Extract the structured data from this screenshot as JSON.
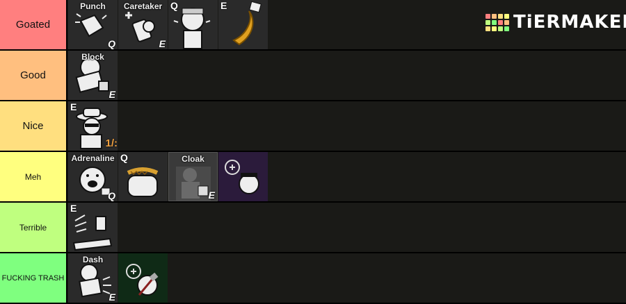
{
  "logo": {
    "text": "TiERMAKER",
    "grid_colors": [
      "#ff7f7f",
      "#ffbf7f",
      "#ffdf7f",
      "#ffff7f",
      "#bfff7f",
      "#7fff7f",
      "#ff7f7f",
      "#ffbf7f",
      "#ffdf7f",
      "#ffff7f",
      "#bfff7f",
      "#7fff7f"
    ]
  },
  "tiers": [
    {
      "label": "Goated",
      "color": "#ff7f7f",
      "font_size": 15,
      "items": [
        {
          "name": "Punch",
          "key_br": "Q",
          "icon": "fist-icon"
        },
        {
          "name": "Caretaker",
          "key_br": "E",
          "icon": "medkit-icon"
        },
        {
          "name": "",
          "key_tl": "Q",
          "icon": "crying-survivor-icon"
        },
        {
          "name": "",
          "key_tl": "E",
          "icon": "banana-icon",
          "variant": "gold"
        }
      ]
    },
    {
      "label": "Good",
      "color": "#ffbf7f",
      "font_size": 15,
      "items": [
        {
          "name": "Block",
          "key_br": "E",
          "icon": "block-survivor-icon"
        }
      ]
    },
    {
      "label": "Nice",
      "color": "#ffdf7f",
      "font_size": 15,
      "items": [
        {
          "name": "",
          "key_tl": "E",
          "badge": "1/:",
          "icon": "fedora-survivor-icon"
        }
      ]
    },
    {
      "label": "Meh",
      "color": "#ffff7f",
      "font_size": 12,
      "items": [
        {
          "name": "Adrenaline",
          "key_br": "Q",
          "icon": "scared-face-icon"
        },
        {
          "name": "",
          "key_tl": "Q",
          "icon": "hotdog-icon"
        },
        {
          "name": "Cloak",
          "key_br": "E",
          "icon": "cloak-icon",
          "variant": "light"
        },
        {
          "name": "",
          "icon": "purple-survivor-icon",
          "variant": "purple"
        }
      ]
    },
    {
      "label": "Terrible",
      "color": "#bfff7f",
      "font_size": 12,
      "items": [
        {
          "name": "",
          "key_tl": "E",
          "icon": "trap-icon"
        }
      ]
    },
    {
      "label": "FUCKING TRASH",
      "color": "#7fff7f",
      "font_size": 11,
      "items": [
        {
          "name": "Dash",
          "key_br": "E",
          "icon": "dash-survivor-icon"
        },
        {
          "name": "",
          "icon": "axe-survivor-icon",
          "variant": "green"
        }
      ]
    }
  ]
}
